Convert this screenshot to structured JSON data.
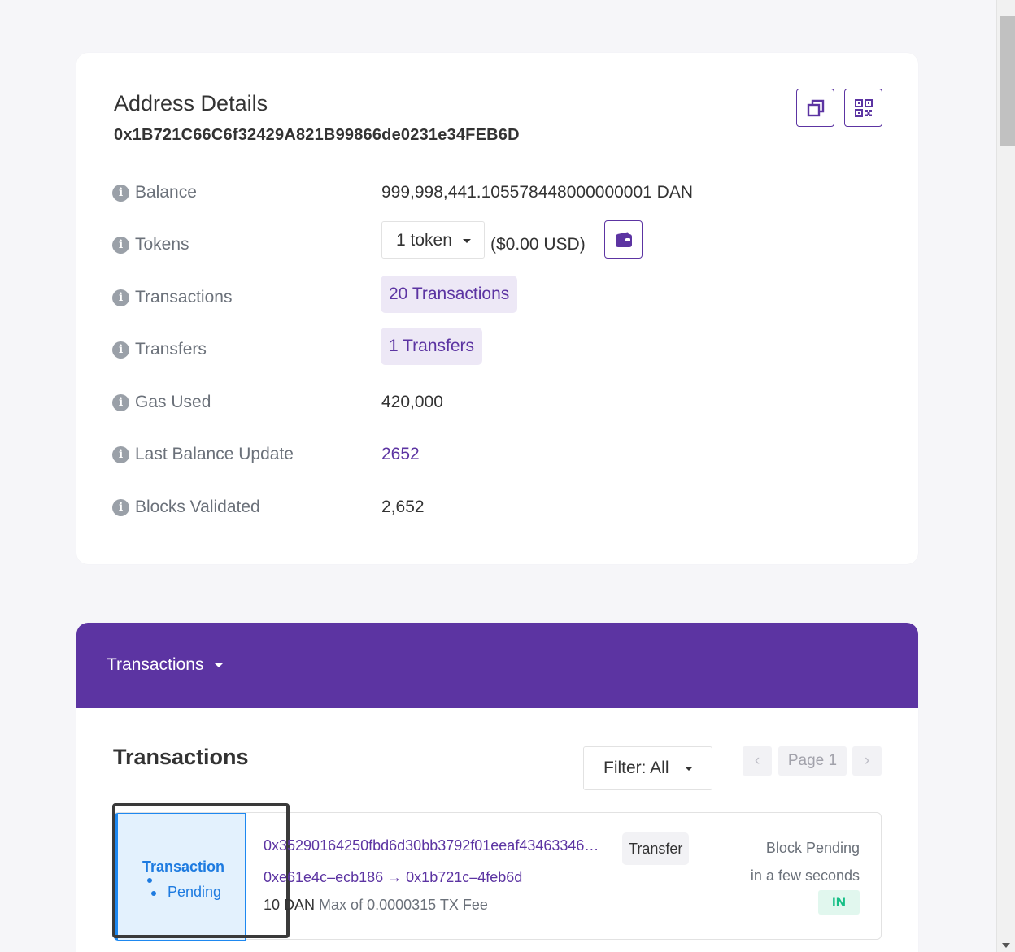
{
  "address_card": {
    "title": "Address Details",
    "address": "0x1B721C66C6f32429A821B99866de0231e34FEB6D",
    "copy_icon": "copy-icon",
    "qr_icon": "qr-code-icon",
    "rows": {
      "balance": {
        "label": "Balance",
        "value": "999,998,441.105578448000000001 DAN"
      },
      "tokens": {
        "label": "Tokens",
        "select": "1 token",
        "usd": "($0.00 USD)",
        "wallet_icon": "wallet-icon"
      },
      "transactions": {
        "label": "Transactions",
        "value": "20 Transactions"
      },
      "transfers": {
        "label": "Transfers",
        "value": "1 Transfers"
      },
      "gas_used": {
        "label": "Gas Used",
        "value": "420,000"
      },
      "last_balance_update": {
        "label": "Last Balance Update",
        "value": "2652"
      },
      "blocks_validated": {
        "label": "Blocks Validated",
        "value": "2,652"
      }
    }
  },
  "tx_card": {
    "header_dropdown": "Transactions",
    "title": "Transactions",
    "filter": "Filter: All",
    "pager": {
      "prev": "‹",
      "page": "Page 1",
      "next": "›"
    },
    "items": [
      {
        "status_line1": "Transaction",
        "status_line2": "Pending",
        "hash": "0x35290164250fbd6d30bb3792f01eeaf43463346…",
        "type": "Transfer",
        "from": "0xe61e4c–ecb186",
        "arrow": "→",
        "to": "0x1b721c–4feb6d",
        "amount": "10 DAN",
        "fee": "Max of 0.0000315 TX Fee",
        "block": "Block Pending",
        "time": "in a few seconds",
        "direction": "IN"
      }
    ]
  },
  "colors": {
    "accent": "#5c34a2",
    "pending_blue": "#1e7be0",
    "in_green": "#15bf86"
  }
}
